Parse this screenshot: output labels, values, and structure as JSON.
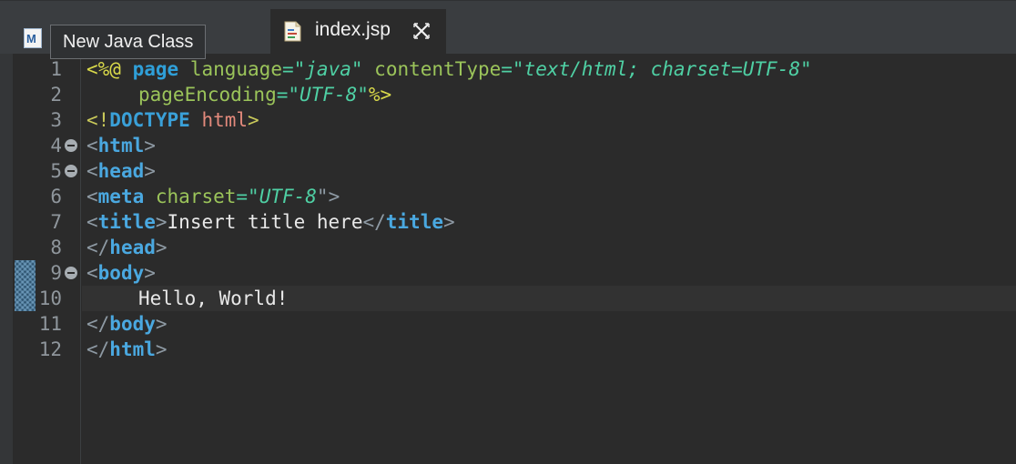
{
  "tabs": {
    "inactive_icon_letter": "M",
    "tooltip": "New Java Class",
    "active_label": "index.jsp"
  },
  "icons": [
    "maven-file-icon",
    "jsp-file-icon",
    "close-tab-icon",
    "fold-toggle-icon"
  ],
  "colors": {
    "background": "#2b2b2b",
    "tabbar": "#3a3d40",
    "tag": "#4aa8e0",
    "attribute": "#9bc45a",
    "value": "#4fd0a4",
    "directive": "#d9d94a",
    "text": "#e8e8e8"
  },
  "editor": {
    "current_line": 10,
    "lines": [
      {
        "n": "1",
        "code": "<%@ page language=\"java\" contentType=\"text/html; charset=UTF-8\""
      },
      {
        "n": "2",
        "code": "    pageEncoding=\"UTF-8\"%>"
      },
      {
        "n": "3",
        "code": "<!DOCTYPE html>"
      },
      {
        "n": "4",
        "code": "<html>"
      },
      {
        "n": "5",
        "code": "<head>"
      },
      {
        "n": "6",
        "code": "<meta charset=\"UTF-8\">"
      },
      {
        "n": "7",
        "code": "<title>Insert title here</title>"
      },
      {
        "n": "8",
        "code": "</head>"
      },
      {
        "n": "9",
        "code": "<body>"
      },
      {
        "n": "10",
        "code": "    Hello, World!"
      },
      {
        "n": "11",
        "code": "</body>"
      },
      {
        "n": "12",
        "code": "</html>"
      }
    ],
    "tokens": {
      "l1": [
        "<%@",
        "page",
        "language",
        "=\"",
        "java",
        "\"",
        "contentType",
        "=\"",
        "text/html; charset=UTF-8",
        "\""
      ],
      "l2": [
        "pageEncoding",
        "=\"",
        "UTF-8",
        "\"",
        "%>"
      ],
      "l3": [
        "<!",
        "DOCTYPE",
        "html",
        ">"
      ],
      "l4": [
        "<",
        "html",
        ">"
      ],
      "l5": [
        "<",
        "head",
        ">"
      ],
      "l6": [
        "<",
        "meta",
        "charset",
        "=\"",
        "UTF-8",
        "\">"
      ],
      "l7": [
        "<",
        "title",
        ">",
        "Insert title here",
        "</",
        "title",
        ">"
      ],
      "l8": [
        "</",
        "head",
        ">"
      ],
      "l9": [
        "<",
        "body",
        ">"
      ],
      "l10": [
        "Hello, World!"
      ],
      "l11": [
        "</",
        "body",
        ">"
      ],
      "l12": [
        "</",
        "html",
        ">"
      ]
    }
  }
}
